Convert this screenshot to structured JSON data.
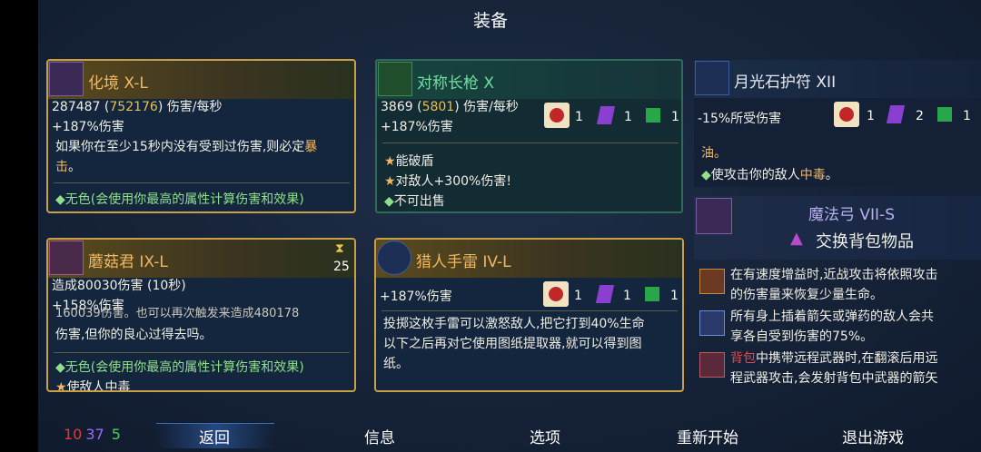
{
  "title": "装备",
  "cards": {
    "melee": {
      "name": "化境 X-L",
      "stat_main": "287487",
      "stat_alt": "752176",
      "stat_unit": "伤害/每秒",
      "bonus": "+187%伤害",
      "desc_a": "如果你在至少15秒内没有受到过伤害,则必定",
      "desc_hl": "暴",
      "desc_b": "击",
      "desc_end": "。",
      "tag": "无色(会使用你最高的属性计算伤害和效果)"
    },
    "spear": {
      "name": "对称长枪 X",
      "stat_main": "3869",
      "stat_alt": "5801",
      "stat_unit": "伤害/每秒",
      "bonus": "+187%伤害",
      "scrolls": [
        "1",
        "1",
        "1"
      ],
      "tag1": "能破盾",
      "tag2": "对敌人+300%伤害!",
      "tag3": "不可出售"
    },
    "amulet": {
      "name": "月光石护符 XII",
      "stat": "-15%所受伤害",
      "scrolls": [
        "1",
        "2",
        "1"
      ],
      "peek": "油。",
      "tag": "使攻击你的敌人",
      "tag_hl": "中毒",
      "tag_end": "。"
    },
    "shroom": {
      "name": "蘑菇君 IX-L",
      "cooldown": "25",
      "stat": "造成80030伤害 (10秒)",
      "bonus": "+158%伤害",
      "peek": "160039伤害。也可以再次触发来造成480178",
      "desc": "伤害,但你的良心过得去吗。",
      "tag": "无色(会使用你最高的属性计算伤害和效果)",
      "tag2": "使敌人中毒"
    },
    "grenade": {
      "name": "猎人手雷 IV-L",
      "bonus": "+187%伤害",
      "scrolls": [
        "1",
        "1",
        "1"
      ],
      "desc_l1": "投掷这枚手雷可以激怒敌人,把它打到40%生命",
      "desc_l2": "以下之后再对它使用图纸提取器,就可以得到图",
      "desc_l3": "纸。"
    },
    "backpack": {
      "name": "魔法弓 VII-S",
      "action": "交换背包物品"
    }
  },
  "mutations": [
    {
      "l1": "在有速度增益时,近战攻击将依照攻击",
      "l2": "的伤害量来恢复少量生命。"
    },
    {
      "l1": "所有身上插着箭矢或弹药的敌人会共",
      "l2": "享各自受到伤害的75%。"
    },
    {
      "l1_hl": "背包",
      "l1": "中携带远程武器时,在翻滚后用远",
      "l2": "程武器攻击,会发射背包中武器的箭矢"
    }
  ],
  "stats": {
    "red": "10",
    "purple": "37",
    "green": "5"
  },
  "nav": [
    "返回",
    "信息",
    "选项",
    "重新开始",
    "退出游戏"
  ],
  "colors": {
    "brutality": "#e03a3a",
    "tactics": "#9b6bf0",
    "survival": "#4ad05a",
    "gold_border": "#c9a046"
  }
}
